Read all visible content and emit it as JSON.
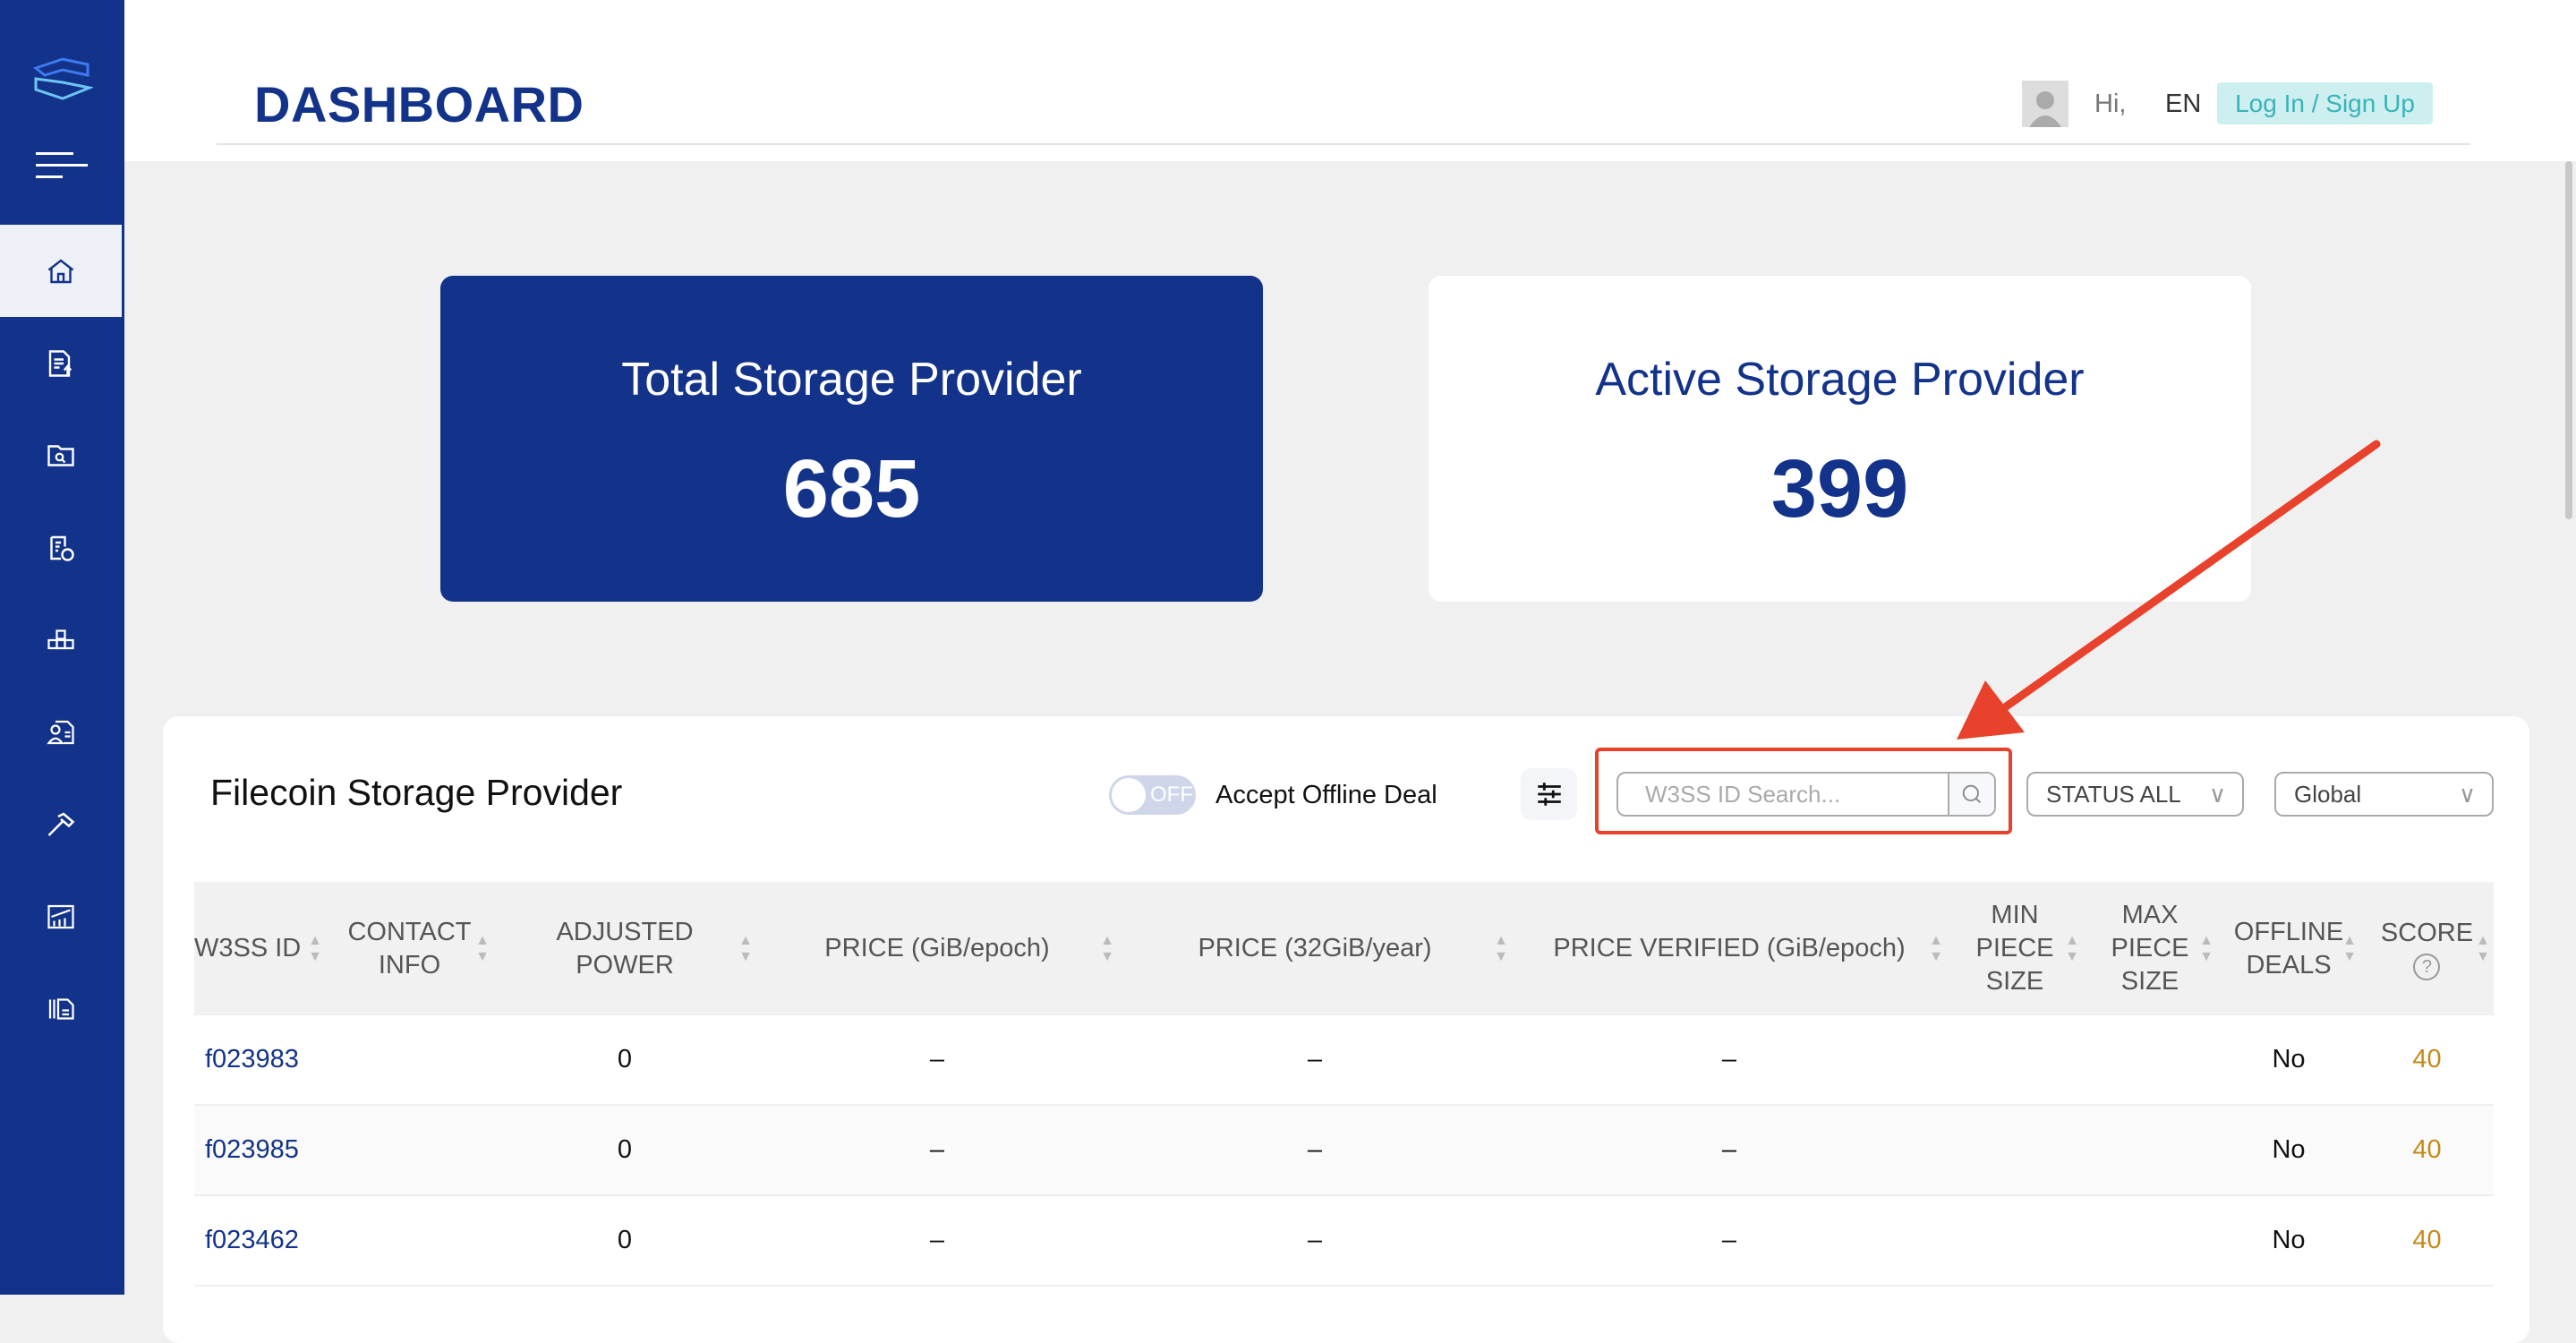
{
  "header": {
    "title": "DASHBOARD",
    "greeting": "Hi,",
    "language": "EN",
    "login_label": "Log In / Sign Up"
  },
  "sidebar": {
    "items": [
      {
        "icon": "home-icon",
        "active": true
      },
      {
        "icon": "document-upload-icon"
      },
      {
        "icon": "folder-search-icon"
      },
      {
        "icon": "clipboard-clock-icon"
      },
      {
        "icon": "cubes-icon"
      },
      {
        "icon": "contact-card-icon"
      },
      {
        "icon": "hammer-icon"
      },
      {
        "icon": "chart-icon"
      },
      {
        "icon": "files-icon"
      }
    ]
  },
  "cards": {
    "total": {
      "label": "Total Storage Provider",
      "value": "685"
    },
    "active": {
      "label": "Active Storage Provider",
      "value": "399"
    }
  },
  "panel": {
    "title": "Filecoin Storage Provider",
    "toggle_state": "OFF",
    "toggle_label": "Accept Offline Deal",
    "search_placeholder": "W3SS ID Search...",
    "status_select": "STATUS ALL",
    "region_select": "Global"
  },
  "table": {
    "columns": [
      "W3SS ID",
      "CONTACT INFO",
      "ADJUSTED POWER",
      "PRICE (GiB/epoch)",
      "PRICE (32GiB/year)",
      "PRICE VERIFIED (GiB/epoch)",
      "MIN PIECE SIZE",
      "MAX PIECE SIZE",
      "OFFLINE DEALS",
      "SCORE"
    ],
    "score_help": "?",
    "rows": [
      [
        "f023983",
        "",
        "0",
        "–",
        "–",
        "–",
        "",
        "",
        "No",
        "40"
      ],
      [
        "f023985",
        "",
        "0",
        "–",
        "–",
        "–",
        "",
        "",
        "No",
        "40"
      ],
      [
        "f023462",
        "",
        "0",
        "–",
        "–",
        "–",
        "",
        "",
        "No",
        "40"
      ]
    ]
  },
  "colors": {
    "brand": "#13338a",
    "highlight": "#e8412c",
    "score": "#c48a1a",
    "login_bg": "#cdeff0"
  }
}
